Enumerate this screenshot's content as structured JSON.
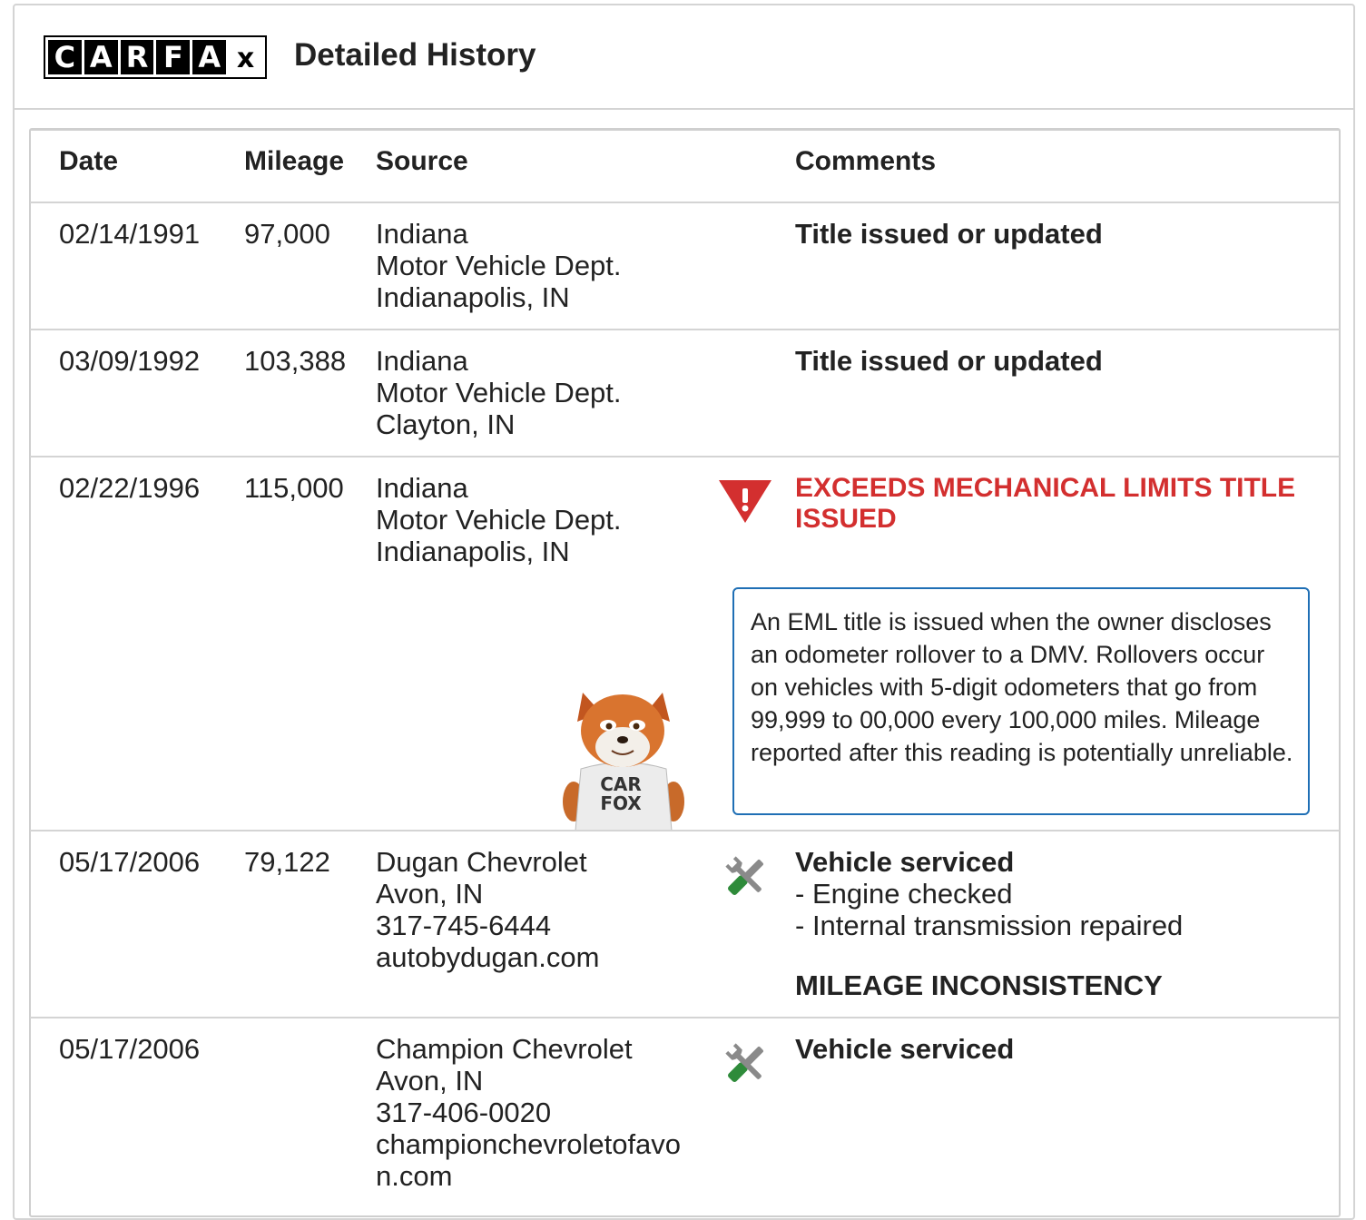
{
  "header": {
    "logo_letters": [
      "C",
      "A",
      "R",
      "F",
      "A",
      "x"
    ],
    "logo_alt": "CARFAX",
    "title": "Detailed History"
  },
  "table": {
    "columns": [
      "Date",
      "Mileage",
      "Source",
      "Comments"
    ],
    "rows": [
      {
        "date": "02/14/1991",
        "mileage": "97,000",
        "source": [
          "Indiana",
          "Motor Vehicle Dept.",
          "Indianapolis, IN"
        ],
        "comment": "Title issued or updated"
      },
      {
        "date": "03/09/1992",
        "mileage": "103,388",
        "source": [
          "Indiana",
          "Motor Vehicle Dept.",
          "Clayton, IN"
        ],
        "comment": "Title issued or updated"
      },
      {
        "date": "02/22/1996",
        "mileage": "115,000",
        "source": [
          "Indiana",
          "Motor Vehicle Dept.",
          "Indianapolis, IN"
        ],
        "alert": "EXCEEDS MECHANICAL LIMITS TITLE ISSUED",
        "info": "An EML title is issued when the owner discloses an odometer rollover to a DMV. Rollovers occur on vehicles with 5-digit odometers that go from 99,999 to 00,000 every 100,000 miles. Mileage reported after this reading is potentially unreliable.",
        "mascot_shirt": [
          "CAR",
          "FOX"
        ]
      },
      {
        "date": "05/17/2006",
        "mileage": "79,122",
        "source": [
          "Dugan Chevrolet",
          "Avon, IN",
          "317-745-6444",
          "autobydugan.com"
        ],
        "comment": "Vehicle serviced",
        "details": [
          "Engine checked",
          "Internal transmission repaired"
        ],
        "flag": "MILEAGE INCONSISTENCY"
      },
      {
        "date": "05/17/2006",
        "mileage": "",
        "source": [
          "Champion Chevrolet",
          "Avon, IN",
          "317-406-0020",
          "championchevroletofavo",
          "n.com"
        ],
        "comment": "Vehicle serviced"
      }
    ]
  },
  "icons": {
    "alert": "warning-triangle-icon",
    "service": "wrench-screwdriver-icon"
  },
  "colors": {
    "alert_red": "#d32f2f",
    "info_border": "#1f6fb5",
    "service_green": "#2e8b3a",
    "rule_gray": "#d4d4d4"
  }
}
